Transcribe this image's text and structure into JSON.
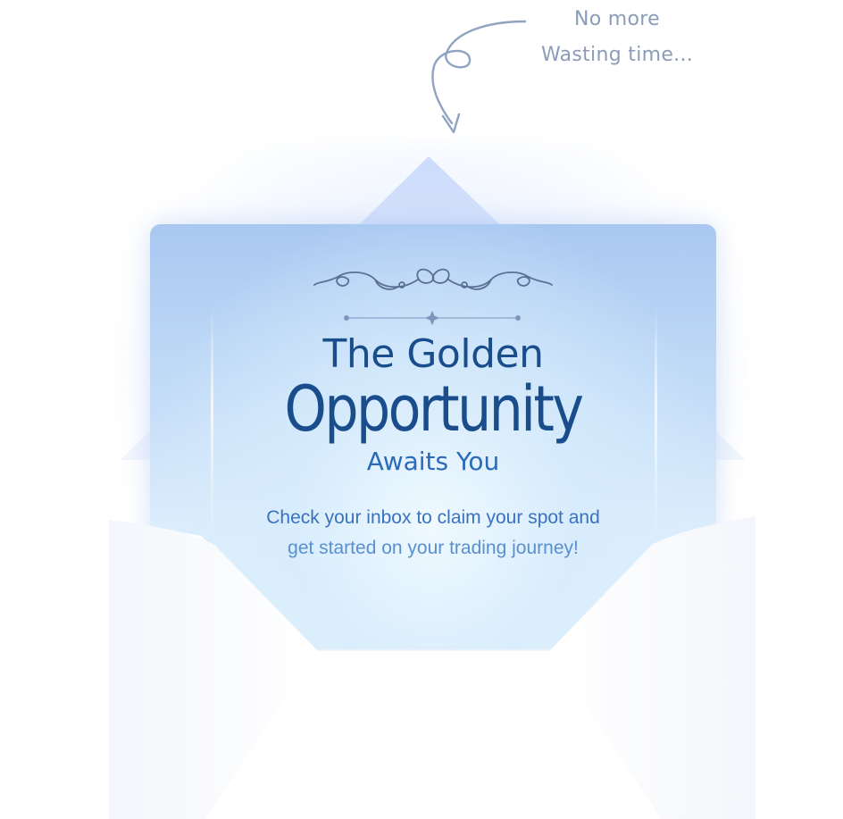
{
  "note": {
    "line1": "No more",
    "line2": "Wasting time..."
  },
  "card": {
    "title_line1": "The Golden",
    "title_line2": "Opportunity",
    "title_line3": "Awaits You",
    "body_line1": "Check your inbox to claim your spot and",
    "body_line2": "get started on your trading journey!"
  },
  "colors": {
    "title": "#1a4d8c",
    "subtitle": "#2a6ab8",
    "body": "#3a72bd",
    "note": "#8a9cb8",
    "card_top": "#a9c8f1",
    "card_bottom": "#e8f4fd"
  },
  "icons": {
    "arrow": "curly-arrow-icon",
    "ornament": "flourish-ornament-icon",
    "divider": "ornamental-divider-icon"
  }
}
